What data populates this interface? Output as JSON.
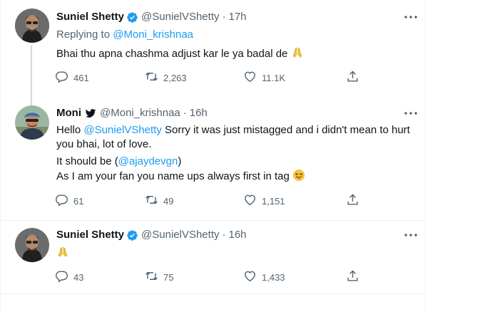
{
  "tweets": [
    {
      "name": "Suniel Shetty",
      "verified": true,
      "handle": "@SunielVShetty",
      "time": "17h",
      "replying_prefix": "Replying to",
      "replying_to": "@Moni_krishnaa",
      "text": "Bhai thu apna chashma adjust kar le ya badal de",
      "replies": "461",
      "retweets": "2,263",
      "likes": "11.1K"
    },
    {
      "name": "Moni",
      "has_twitter_bird": true,
      "handle": "@Moni_krishnaa",
      "time": "16h",
      "line1_pre": "Hello",
      "line1_mention": "@SunielVShetty",
      "line1_post": "Sorry it was just mistagged and i didn't mean to hurt",
      "line2": "you bhai, lot of love.",
      "line3_pre": "It should be (",
      "line3_mention": "@ajaydevgn",
      "line3_post": ")",
      "line4": "As I am your fan you name ups always first in tag",
      "replies": "61",
      "retweets": "49",
      "likes": "1,151"
    },
    {
      "name": "Suniel Shetty",
      "verified": true,
      "handle": "@SunielVShetty",
      "time": "16h",
      "replies": "43",
      "retweets": "75",
      "likes": "1,433"
    }
  ],
  "separator": "·",
  "colors": {
    "verified": "#1d9bf0",
    "link": "#1d9bf0",
    "muted": "#536471"
  }
}
